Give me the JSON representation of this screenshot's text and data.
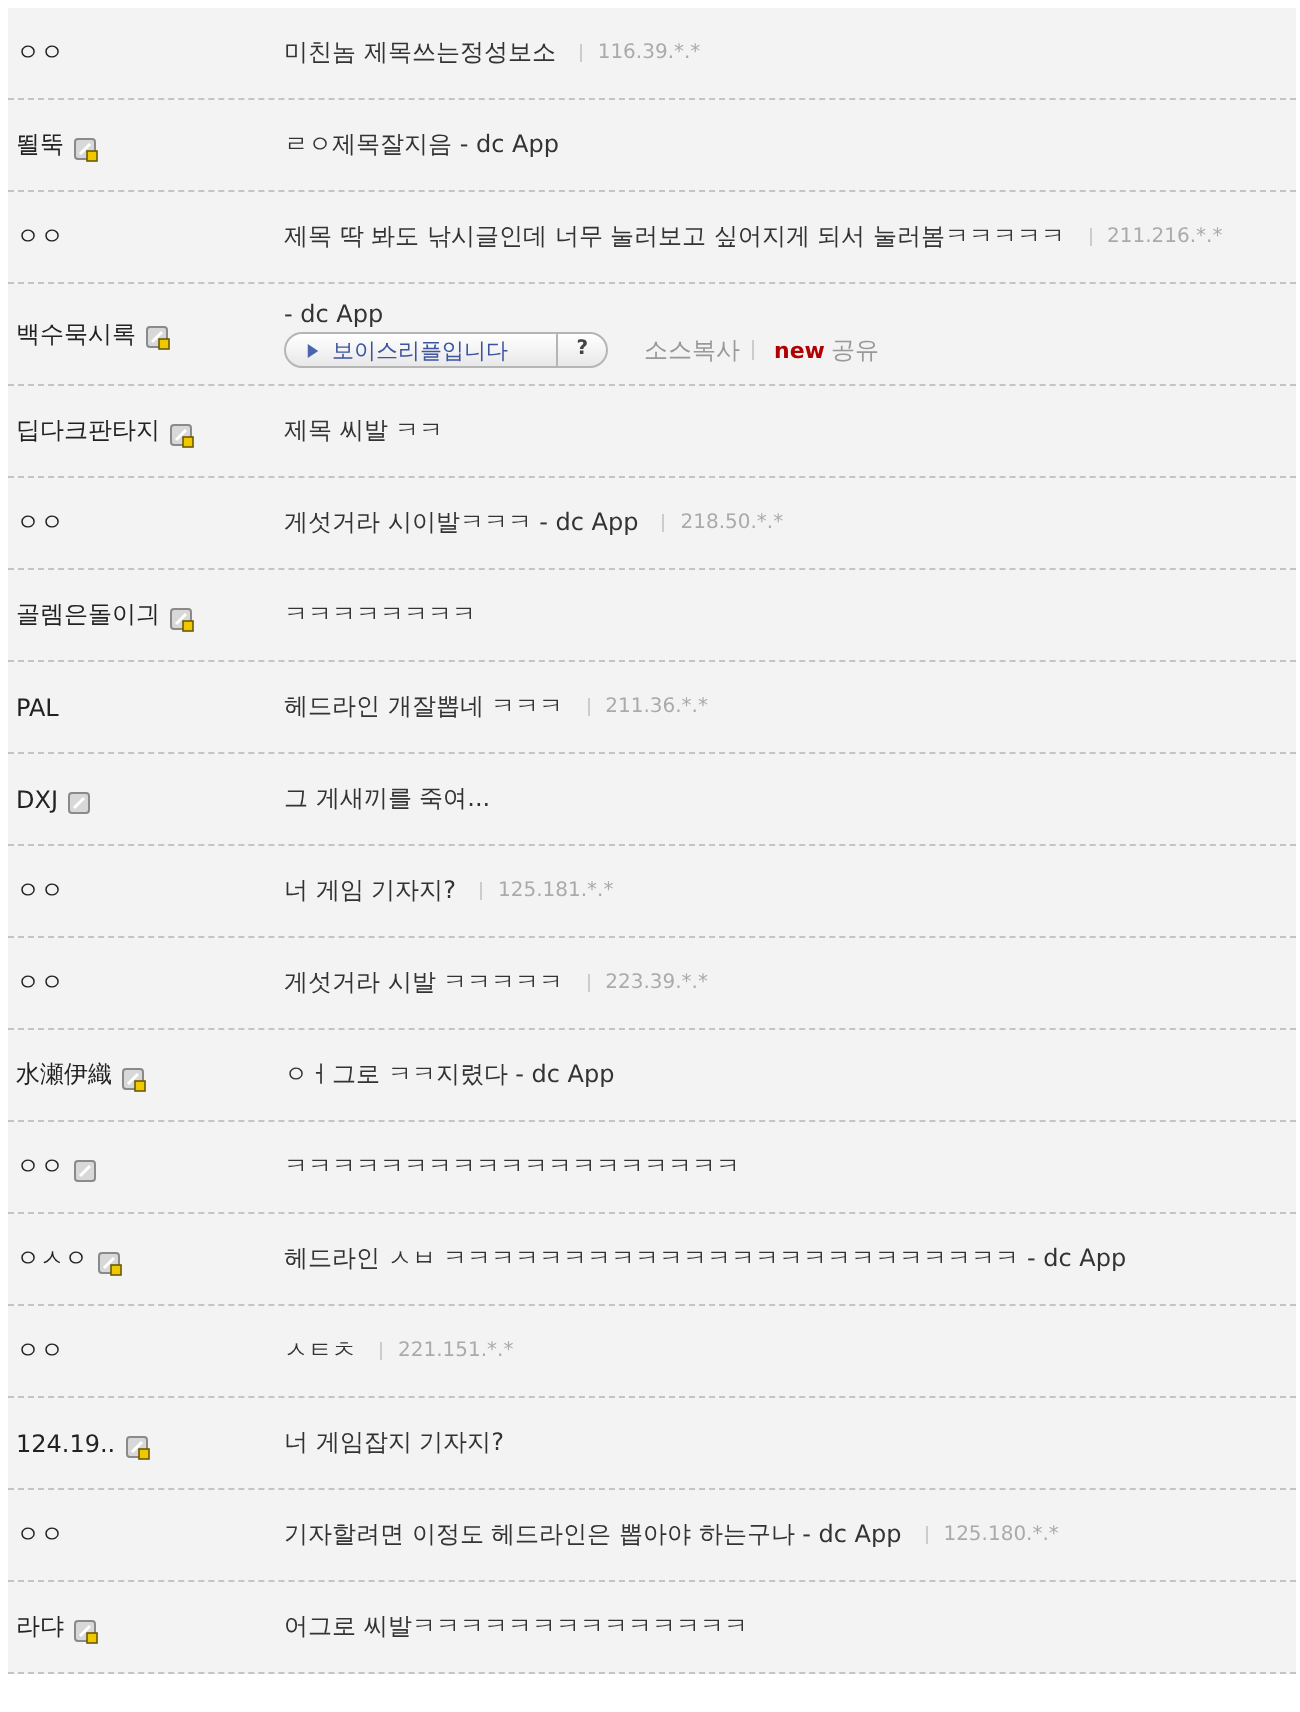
{
  "comments": [
    {
      "name": "ㅇㅇ",
      "kind": "none",
      "text": "미친놈 제목쓰는정성보소",
      "ip": "116.39.*.*"
    },
    {
      "name": "뙬뚝",
      "kind": "fixed",
      "text": "ㄹㅇ제목잘지음 - dc App"
    },
    {
      "name": "ㅇㅇ",
      "kind": "none",
      "text": "제목 딱 봐도 낚시글인데 너무 눌러보고 싶어지게 되서 눌러봄ㅋㅋㅋㅋㅋ",
      "ip": "211.216.*.*"
    },
    {
      "name": "백수묵시록",
      "kind": "fixed",
      "text": "- dc App",
      "voice": {
        "label": "보이스리플입니다",
        "help": "?",
        "copy": "소스복사",
        "new_tag": "new",
        "share": "공유"
      }
    },
    {
      "name": "딥다크판타지",
      "kind": "fixed",
      "text": "제목 씨발 ㅋㅋ"
    },
    {
      "name": "ㅇㅇ",
      "kind": "none",
      "text": "게섯거라 시이발ㅋㅋㅋ - dc App",
      "ip": "218.50.*.*"
    },
    {
      "name": "골렘은돌이긔",
      "kind": "fixed",
      "text": "ㅋㅋㅋㅋㅋㅋㅋㅋ"
    },
    {
      "name": "PAL",
      "kind": "none",
      "text": "헤드라인 개잘뽑네 ㅋㅋㅋ",
      "ip": "211.36.*.*"
    },
    {
      "name": "DXJ",
      "kind": "half",
      "text": "그 게새끼를 죽여..."
    },
    {
      "name": "ㅇㅇ",
      "kind": "none",
      "text": "너 게임 기자지?",
      "ip": "125.181.*.*"
    },
    {
      "name": "ㅇㅇ",
      "kind": "none",
      "text": "게섯거라 시발 ㅋㅋㅋㅋㅋ",
      "ip": "223.39.*.*"
    },
    {
      "name": "水瀬伊織",
      "kind": "fixed",
      "text": "ㅇㅓ그로 ㅋㅋ지렸다 - dc App"
    },
    {
      "name": "ㅇㅇ",
      "kind": "half",
      "text": "ㅋㅋㅋㅋㅋㅋㅋㅋㅋㅋㅋㅋㅋㅋㅋㅋㅋㅋㅋ"
    },
    {
      "name": "ㅇㅅㅇ",
      "kind": "fixed",
      "text": "헤드라인 ㅅㅂ ㅋㅋㅋㅋㅋㅋㅋㅋㅋㅋㅋㅋㅋㅋㅋㅋㅋㅋㅋㅋㅋㅋㅋㅋ - dc App"
    },
    {
      "name": "ㅇㅇ",
      "kind": "none",
      "text": "ㅅㅌㅊ",
      "ip": "221.151.*.*"
    },
    {
      "name": "124.19..",
      "kind": "fixed",
      "text": "너 게임잡지 기자지?"
    },
    {
      "name": "ㅇㅇ",
      "kind": "none",
      "text": "기자할려면 이정도 헤드라인은 뽑아야 하는구나 - dc App",
      "ip": "125.180.*.*"
    },
    {
      "name": "라댜",
      "kind": "fixed",
      "text": "어그로 씨발ㅋㅋㅋㅋㅋㅋㅋㅋㅋㅋㅋㅋㅋㅋ"
    }
  ]
}
